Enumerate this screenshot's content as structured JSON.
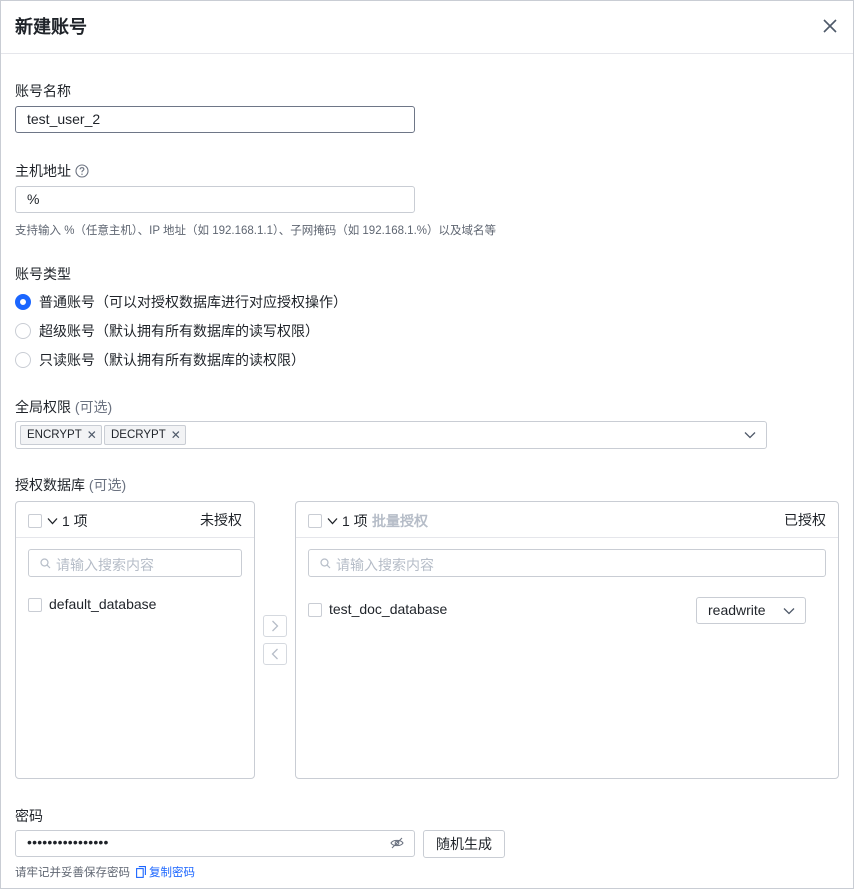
{
  "dialog": {
    "title": "新建账号"
  },
  "account_name": {
    "label": "账号名称",
    "value": "test_user_2"
  },
  "host": {
    "label": "主机地址",
    "value": "%",
    "hint": "支持输入 %（任意主机）、IP 地址（如 192.168.1.1）、子网掩码（如 192.168.1.%）以及域名等"
  },
  "account_type": {
    "label": "账号类型",
    "options": [
      {
        "label": "普通账号（可以对授权数据库进行对应授权操作）",
        "selected": true
      },
      {
        "label": "超级账号（默认拥有所有数据库的读写权限）",
        "selected": false
      },
      {
        "label": "只读账号（默认拥有所有数据库的读权限）",
        "selected": false
      }
    ]
  },
  "global_privileges": {
    "label": "全局权限",
    "optional": "(可选)",
    "tags": [
      "ENCRYPT",
      "DECRYPT"
    ]
  },
  "databases": {
    "label": "授权数据库",
    "optional": "(可选)",
    "left": {
      "count": "1 项",
      "side_label": "未授权",
      "search_placeholder": "请输入搜索内容",
      "items": [
        {
          "name": "default_database"
        }
      ]
    },
    "right": {
      "count": "1 项",
      "batch_label": "批量授权",
      "side_label": "已授权",
      "search_placeholder": "请输入搜索内容",
      "items": [
        {
          "name": "test_doc_database",
          "permission": "readwrite"
        }
      ]
    },
    "move_right": ">",
    "move_left": "<"
  },
  "password": {
    "label": "密码",
    "value": "••••••••••••••••",
    "generate_label": "随机生成",
    "hint": "请牢记并妥善保存密码",
    "copy_label": "复制密码"
  },
  "colors": {
    "primary": "#1b66ff",
    "border": "#c9cdd4",
    "muted": "#b6bdc8"
  }
}
